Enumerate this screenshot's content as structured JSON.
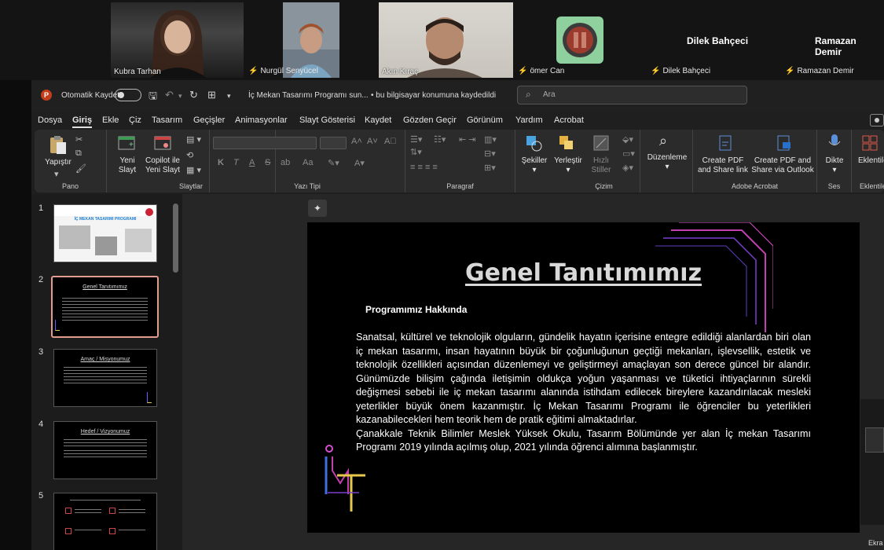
{
  "participants": [
    {
      "name": "Kubra Tarhan",
      "muted": false
    },
    {
      "name": "Nurgül Senyücel",
      "muted": true
    },
    {
      "name": "Akın Kıraç",
      "muted": false
    },
    {
      "name": "ömer Can",
      "muted": true
    },
    {
      "name": "Dilek Bahçeci",
      "muted": true
    },
    {
      "name": "Ramazan Demir",
      "muted": true
    }
  ],
  "titlebar": {
    "autosave_label": "Otomatik Kaydet",
    "doc_title": "İç Mekan Tasarımı Programı sun...",
    "save_location": "• bu bilgisayar konumuna kaydedildi",
    "search_placeholder": "Ara"
  },
  "menu": [
    "Dosya",
    "Giriş",
    "Ekle",
    "Çiz",
    "Tasarım",
    "Geçişler",
    "Animasyonlar",
    "Slayt Gösterisi",
    "Kaydet",
    "Gözden Geçir",
    "Görünüm",
    "Yardım",
    "Acrobat"
  ],
  "ribbon": {
    "paste": "Yapıştır",
    "new_slide": [
      "Yeni",
      "Slayt"
    ],
    "copilot": [
      "Copilot ile",
      "Yeni Slayt"
    ],
    "shapes": "Şekiller",
    "arrange": "Yerleştir",
    "quick_styles": [
      "Hızlı",
      "Stiller"
    ],
    "editing": "Düzenleme",
    "create_pdf_share": [
      "Create PDF",
      "and Share link"
    ],
    "create_pdf_outlook": [
      "Create PDF and",
      "Share via Outlook"
    ],
    "dictate": "Dikte",
    "addins": "Eklentiler",
    "groups": {
      "clipboard": "Pano",
      "slides": "Slaytlar",
      "font": "Yazı Tipi",
      "paragraph": "Paragraf",
      "drawing": "Çizim",
      "adobe": "Adobe Acrobat",
      "voice": "Ses",
      "addins": "Eklentile"
    },
    "font_buttons": [
      "K",
      "T",
      "A",
      "S",
      "ab",
      "Aa"
    ]
  },
  "thumbnails": [
    {
      "num": "1",
      "title": "İÇ MEKAN TASARIMI PROGRAMI"
    },
    {
      "num": "2",
      "title": "Genel Tanıtımımız"
    },
    {
      "num": "3",
      "title": "Amaç / Misyonumuz"
    },
    {
      "num": "4",
      "title": "Hedef / Vizyonumuz"
    },
    {
      "num": "5",
      "title": ""
    }
  ],
  "slide": {
    "title": "Genel Tanıtımımız",
    "subtitle": "Programımız Hakkında",
    "paragraph1": "Sanatsal, kültürel ve teknolojik olguların, gündelik hayatın içerisine entegre edildiği alanlardan biri olan iç mekan tasarımı, insan hayatının büyük bir çoğunluğunun geçtiği mekanları, işlevsellik, estetik ve teknolojik özellikleri açısından düzenlemeyi ve geliştirmeyi amaçlayan son derece güncel bir alandır. Günümüzde bilişim çağında iletişimin oldukça yoğun yaşanması ve tüketici ihtiyaçlarının sürekli değişmesi sebebi ile iç mekan tasarımı alanında istihdam edilecek bireylere kazandırılacak mesleki yeterlikler büyük önem kazanmıştır. İç Mekan Tasarımı Programı ile öğrenciler bu yeterlikleri kazanabilecekleri hem teorik hem de pratik eğitimi almaktadırlar.",
    "paragraph2": "Çanakkale Teknik Bilimler Meslek Yüksek Okulu, Tasarım Bölümünde yer alan İç mekan Tasarımı Programı 2019 yılında açılmış olup, 2021 yılında öğrenci alımına başlanmıştır."
  },
  "misc": {
    "right_edge_label": "Ekra"
  }
}
